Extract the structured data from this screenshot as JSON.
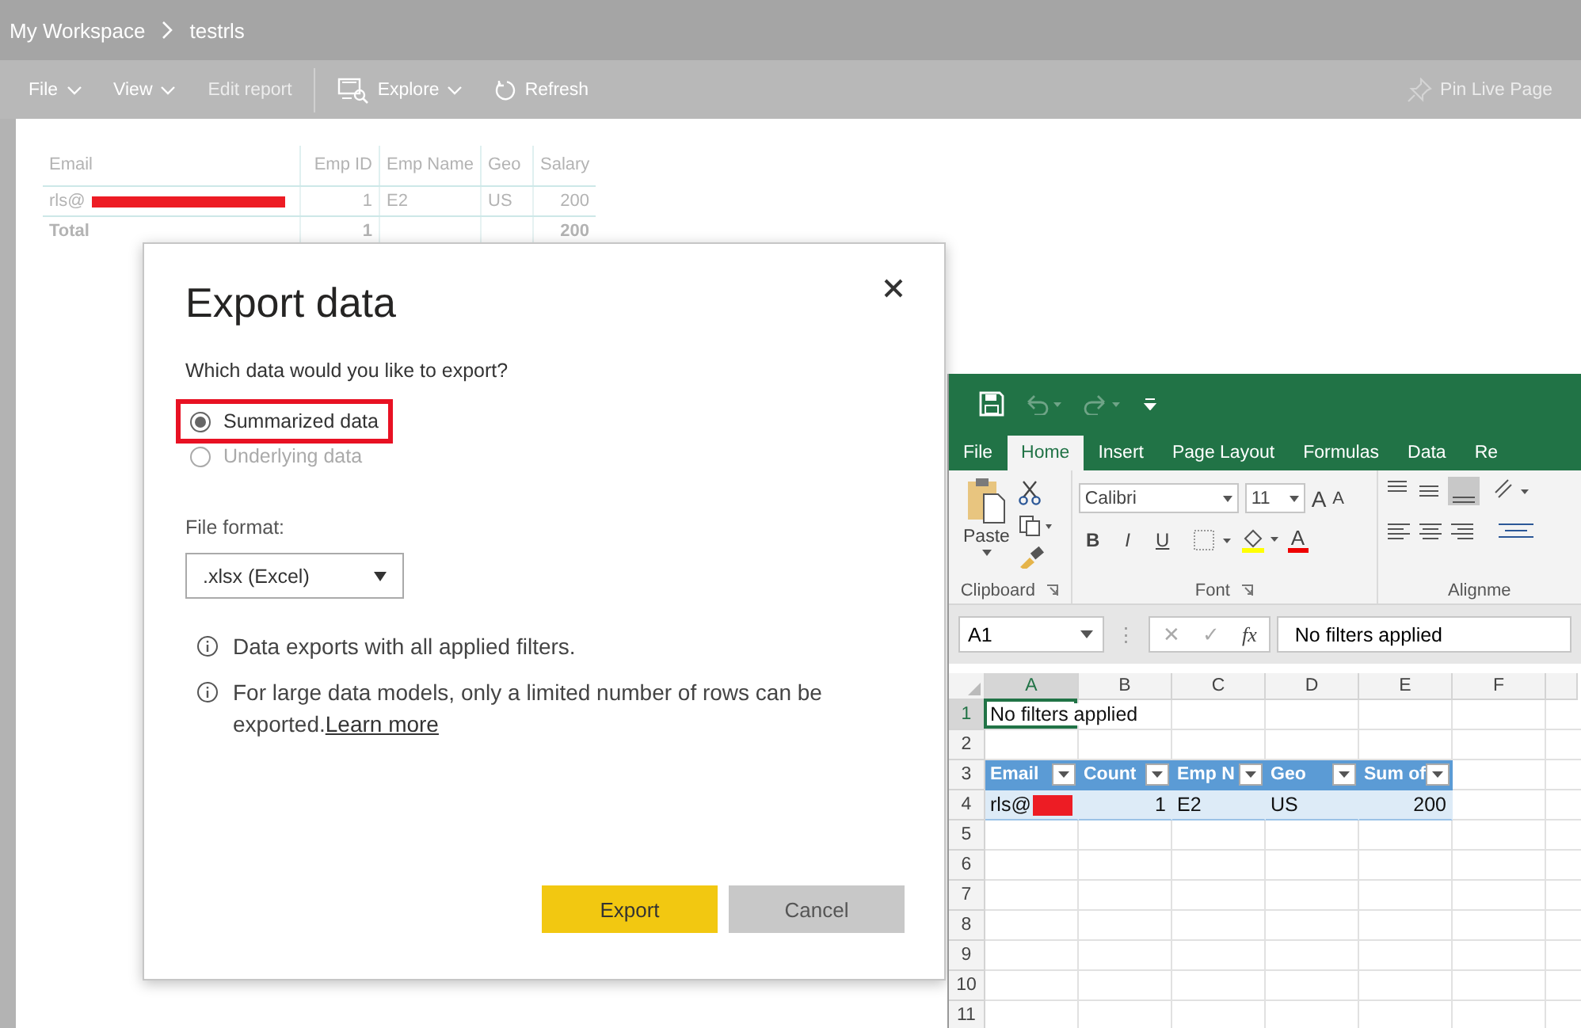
{
  "breadcrumb": {
    "workspace": "My Workspace",
    "report": "testrls"
  },
  "toolbar": {
    "items": [
      {
        "label": "File",
        "kind": "menu",
        "disabled": false
      },
      {
        "label": "View",
        "kind": "menu",
        "disabled": false
      },
      {
        "label": "Edit report",
        "kind": "plain",
        "disabled": true
      },
      {
        "label": "Explore",
        "kind": "explore",
        "disabled": false
      },
      {
        "label": "Refresh",
        "kind": "refresh",
        "disabled": false
      }
    ],
    "right": [
      {
        "label": "Pin Live Page",
        "kind": "pin",
        "disabled": true
      }
    ]
  },
  "table": {
    "columns": [
      "Email",
      "Emp ID",
      "Emp Name",
      "Geo",
      "Salary"
    ],
    "rows": [
      {
        "cells": [
          "rls@",
          "1",
          "E2",
          "US",
          "200"
        ],
        "redacted": true
      }
    ],
    "total": {
      "label": "Total",
      "emp_id": "1",
      "salary": "200"
    }
  },
  "dialog": {
    "title": "Export data",
    "question": "Which data would you like to export?",
    "options": [
      {
        "label": "Summarized data",
        "selected": true,
        "disabled": false,
        "highlighted": true
      },
      {
        "label": "Underlying data",
        "selected": false,
        "disabled": true,
        "highlighted": false
      }
    ],
    "format_label": "File format:",
    "format_value": ".xlsx (Excel)",
    "notes": [
      {
        "text": "Data exports with all applied filters."
      },
      {
        "text": "For large data models, only a limited number of rows can be exported.",
        "link": "Learn more"
      }
    ],
    "buttons": [
      {
        "label": "Export",
        "kind": "primary"
      },
      {
        "label": "Cancel",
        "kind": "secondary"
      }
    ]
  },
  "excel": {
    "tabs": [
      {
        "label": "File",
        "selected": false
      },
      {
        "label": "Home",
        "selected": true
      },
      {
        "label": "Insert",
        "selected": false
      },
      {
        "label": "Page Layout",
        "selected": false
      },
      {
        "label": "Formulas",
        "selected": false
      },
      {
        "label": "Data",
        "selected": false
      },
      {
        "label": "Re",
        "selected": false
      }
    ],
    "paste_label": "Paste",
    "font_name": "Calibri",
    "font_size": "11",
    "font_buttons": [
      "B",
      "I",
      "U"
    ],
    "grow_label": "A",
    "shrink_label": "A",
    "color_label": "A",
    "groups": [
      "Clipboard",
      "Font",
      "Alignme"
    ],
    "name_box": "A1",
    "formula_separator": "⋮",
    "formula_buttons": [
      "✕",
      "✓",
      "fx"
    ],
    "formula": "No filters applied",
    "columns": [
      "A",
      "B",
      "C",
      "D",
      "E",
      "F"
    ],
    "rows": [
      {
        "number": "1",
        "cells": [
          "No filters applied",
          null,
          null,
          null,
          null,
          null
        ],
        "kind": "plain"
      },
      {
        "number": "2",
        "cells": [
          null,
          null,
          null,
          null,
          null,
          null
        ],
        "kind": "plain"
      },
      {
        "number": "3",
        "cells": [
          "Email",
          "Count",
          "Emp N",
          "Geo",
          "Sum of",
          null
        ],
        "kind": "header"
      },
      {
        "number": "4",
        "cells": [
          "rls@",
          "1",
          "E2",
          "US",
          "200",
          null
        ],
        "kind": "band",
        "redacted": true
      },
      {
        "number": "5",
        "cells": [
          null,
          null,
          null,
          null,
          null,
          null
        ],
        "kind": "plain"
      },
      {
        "number": "6",
        "cells": [
          null,
          null,
          null,
          null,
          null,
          null
        ],
        "kind": "plain"
      },
      {
        "number": "7",
        "cells": [
          null,
          null,
          null,
          null,
          null,
          null
        ],
        "kind": "plain"
      },
      {
        "number": "8",
        "cells": [
          null,
          null,
          null,
          null,
          null,
          null
        ],
        "kind": "plain"
      },
      {
        "number": "9",
        "cells": [
          null,
          null,
          null,
          null,
          null,
          null
        ],
        "kind": "plain"
      },
      {
        "number": "10",
        "cells": [
          null,
          null,
          null,
          null,
          null,
          null
        ],
        "kind": "plain"
      },
      {
        "number": "11",
        "cells": [
          null,
          null,
          null,
          null,
          null,
          null
        ],
        "kind": "plain"
      }
    ]
  }
}
